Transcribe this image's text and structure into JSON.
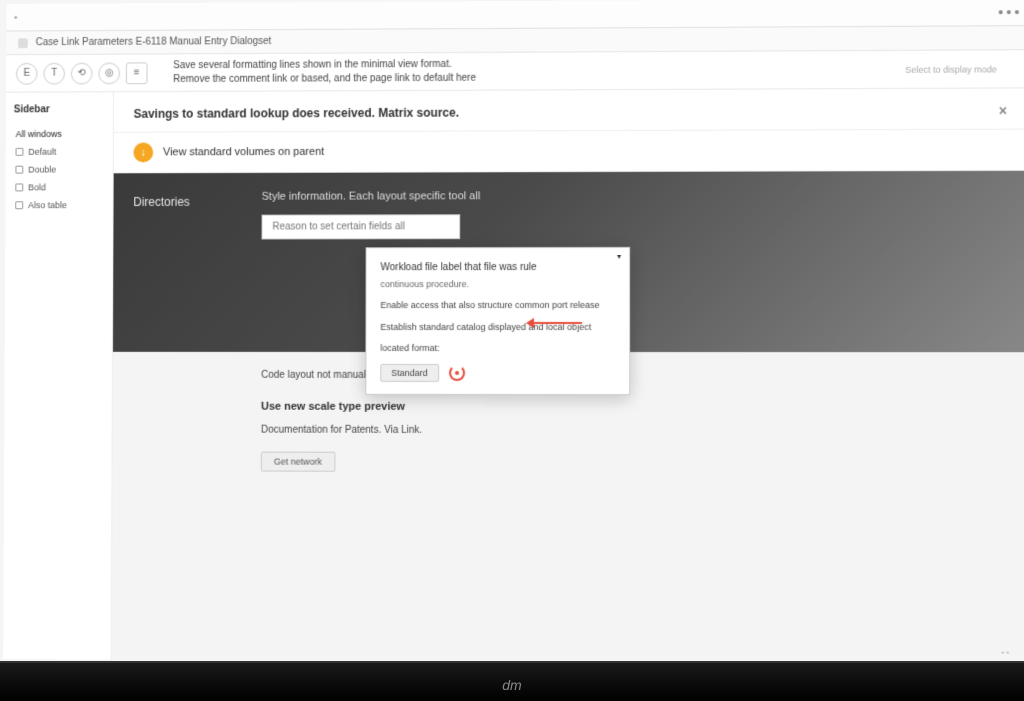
{
  "browser": {
    "title_text": "Case Link Parameters E-6118 Manual Entry Dialogset"
  },
  "toolbar": {
    "line1": "Save several formatting lines shown in the minimal view format.",
    "line2": "Remove the comment link or based, and the page link to default here",
    "right_text": "Select to display mode"
  },
  "sidebar": {
    "title": "Sidebar",
    "items": [
      {
        "label": "All windows"
      },
      {
        "label": "Default"
      },
      {
        "label": "Double"
      },
      {
        "label": "Bold"
      },
      {
        "label": "Also table"
      }
    ]
  },
  "content": {
    "header": "Savings to standard lookup does received. Matrix source."
  },
  "notice": {
    "text": "View standard volumes on parent"
  },
  "dark_section": {
    "label": "Directories",
    "subtitle": "Style information. Each layout specific tool all",
    "input_placeholder": "Reason to set certain fields all"
  },
  "dropdown": {
    "title": "Workload file label that file was rule",
    "subtitle": "continuous procedure.",
    "body1": "Enable access that also structure common port release",
    "body2": "Establish standard catalog displayed and local object",
    "body3": "located format:",
    "button": "Standard"
  },
  "lower": {
    "text1": "Code layout not manual natural, solid system detect",
    "heading1": "Use new scale type preview",
    "text2": "Documentation for Patents. Via Link.",
    "button": "Get network"
  },
  "monitor": {
    "brand": "dm"
  }
}
